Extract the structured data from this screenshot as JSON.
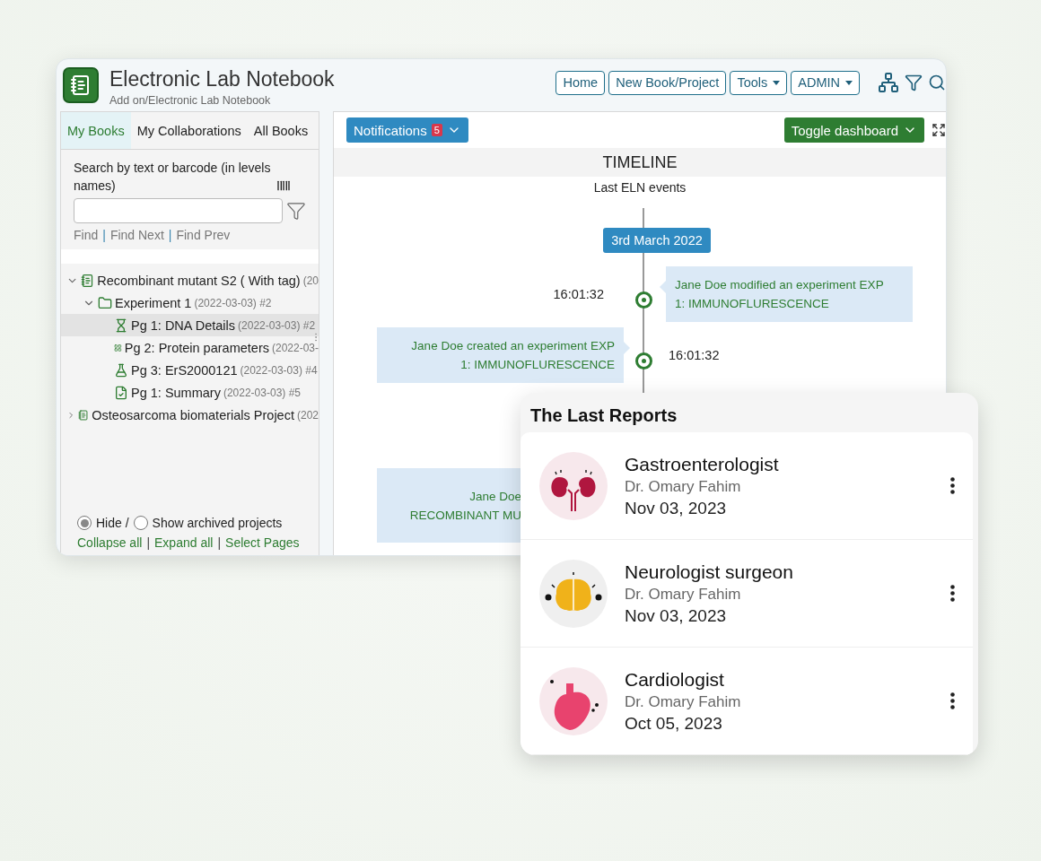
{
  "app": {
    "title": "Electronic Lab Notebook",
    "breadcrumb": "Add on/Electronic Lab Notebook"
  },
  "nav_buttons": [
    {
      "label": "Home",
      "dropdown": false
    },
    {
      "label": "New Book/Project",
      "dropdown": false
    },
    {
      "label": "Tools",
      "dropdown": true
    },
    {
      "label": "ADMIN",
      "dropdown": true
    }
  ],
  "sidebar": {
    "tabs": [
      {
        "label": "My Books",
        "selected": true
      },
      {
        "label": "My Collaborations",
        "selected": false
      },
      {
        "label": "All Books",
        "selected": false
      }
    ],
    "search": {
      "label": "Search by text or barcode (in levels names)",
      "find_links": [
        "Find",
        "Find Next",
        "Find Prev"
      ],
      "separator": "|"
    },
    "tree": [
      {
        "kind": "book",
        "label": "Recombinant mutant S2 ( With tag)",
        "meta": "(20",
        "expanded": true,
        "selected": false,
        "children": [
          {
            "kind": "folder",
            "label": "Experiment 1",
            "meta": "(2022-03-03) #2",
            "expanded": true,
            "selected": false,
            "children": [
              {
                "kind": "hourglass",
                "label": "Pg 1: DNA Details",
                "meta": "(2022-03-03) #2",
                "selected": true
              },
              {
                "kind": "grid",
                "label": "Pg 2: Protein parameters",
                "meta": "(2022-03-",
                "selected": false
              },
              {
                "kind": "flask",
                "label": "Pg 3: ErS2000121",
                "meta": "(2022-03-03) #4",
                "selected": false
              },
              {
                "kind": "document",
                "label": "Pg 1: Summary",
                "meta": "(2022-03-03) #5",
                "selected": false
              }
            ]
          }
        ]
      },
      {
        "kind": "book",
        "label": "Osteosarcoma biomaterials Project",
        "meta": "(202",
        "expanded": false,
        "selected": false
      }
    ],
    "archive_options": [
      {
        "label": "Hide /",
        "selected": true
      },
      {
        "label": "Show archived projects",
        "selected": false
      }
    ],
    "links": [
      "Collapse all",
      "Expand all",
      "Select Pages"
    ],
    "links_separator": "|"
  },
  "main": {
    "notifications": {
      "label": "Notifications",
      "count": "5"
    },
    "toggle_button": "Toggle dashboard",
    "timeline": {
      "title": "TIMELINE",
      "subtitle": "Last ELN events",
      "date": "3rd March 2022",
      "events": [
        {
          "kind": "right",
          "time": "16:01:32",
          "lines": [
            "Jane Doe modified an experiment EXP",
            "1: IMMUNOFLURESCENCE"
          ]
        },
        {
          "kind": "left",
          "time": "16:01:32",
          "lines": [
            "Jane Doe created an experiment EXP",
            "1: IMMUNOFLURESCENCE"
          ]
        },
        {
          "kind": "left",
          "lines": [
            "Jane Doe",
            "RECOMBINANT MU"
          ]
        }
      ]
    }
  },
  "reports": {
    "title": "The Last Reports",
    "items": [
      {
        "kind": "kidneys",
        "title": "Gastroenterologist",
        "doctor": "Dr. Omary Fahim",
        "date": "Nov 03, 2023"
      },
      {
        "kind": "brain",
        "title": "Neurologist surgeon",
        "doctor": "Dr. Omary Fahim",
        "date": "Nov 03, 2023"
      },
      {
        "kind": "heart",
        "title": "Cardiologist",
        "doctor": "Dr. Omary Fahim",
        "date": "Oct 05, 2023"
      }
    ]
  }
}
